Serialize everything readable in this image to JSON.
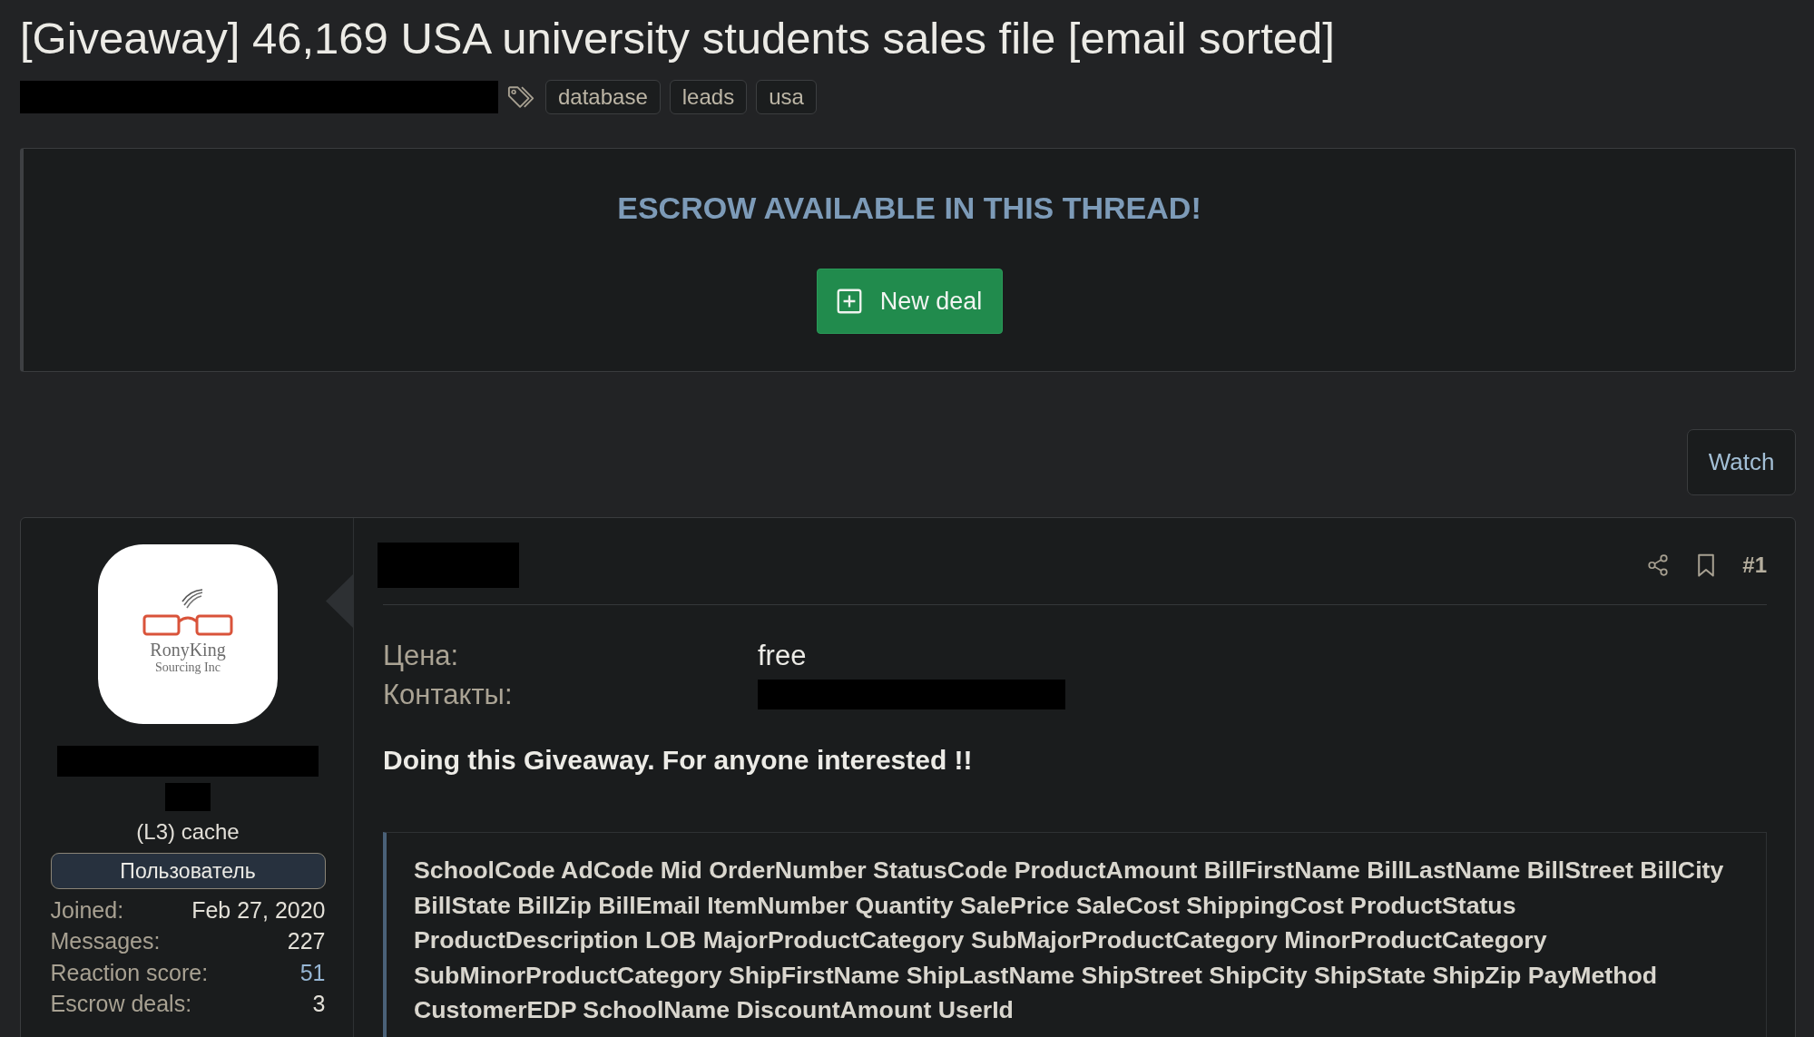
{
  "thread": {
    "title": "[Giveaway] 46,169 USA university students sales file [email sorted]",
    "tags": [
      "database",
      "leads",
      "usa"
    ]
  },
  "escrow_banner": {
    "heading": "ESCROW AVAILABLE IN THIS THREAD!",
    "button": "New deal"
  },
  "watch_button": "Watch",
  "post": {
    "author": {
      "avatar": {
        "logo_name": "RonyKing",
        "logo_tagline": "Sourcing Inc"
      },
      "user_title": "(L3) cache",
      "role_badge": "Пользователь",
      "stats": [
        {
          "label": "Joined:",
          "value": "Feb 27, 2020",
          "kind": "plain"
        },
        {
          "label": "Messages:",
          "value": "227",
          "kind": "plain"
        },
        {
          "label": "Reaction score:",
          "value": "51",
          "kind": "link"
        },
        {
          "label": "Escrow deals:",
          "value": "3",
          "kind": "plain"
        }
      ]
    },
    "number": "#1",
    "fields": [
      {
        "label": "Цена:",
        "value": "free",
        "kind": "text"
      },
      {
        "label": "Контакты:",
        "kind": "redacted"
      }
    ],
    "lead": "Doing this Giveaway. For anyone interested !!",
    "quote": "SchoolCode AdCode Mid OrderNumber StatusCode ProductAmount BillFirstName BillLastName BillStreet BillCity BillState BillZip BillEmail ItemNumber Quantity SalePrice SaleCost ShippingCost ProductStatus ProductDescription LOB MajorProductCategory SubMajorProductCategory MinorProductCategory SubMinorProductCategory ShipFirstName ShipLastName ShipStreet ShipCity ShipState ShipZip PayMethod CustomerEDP SchoolName DiscountAmount UserId"
  }
}
